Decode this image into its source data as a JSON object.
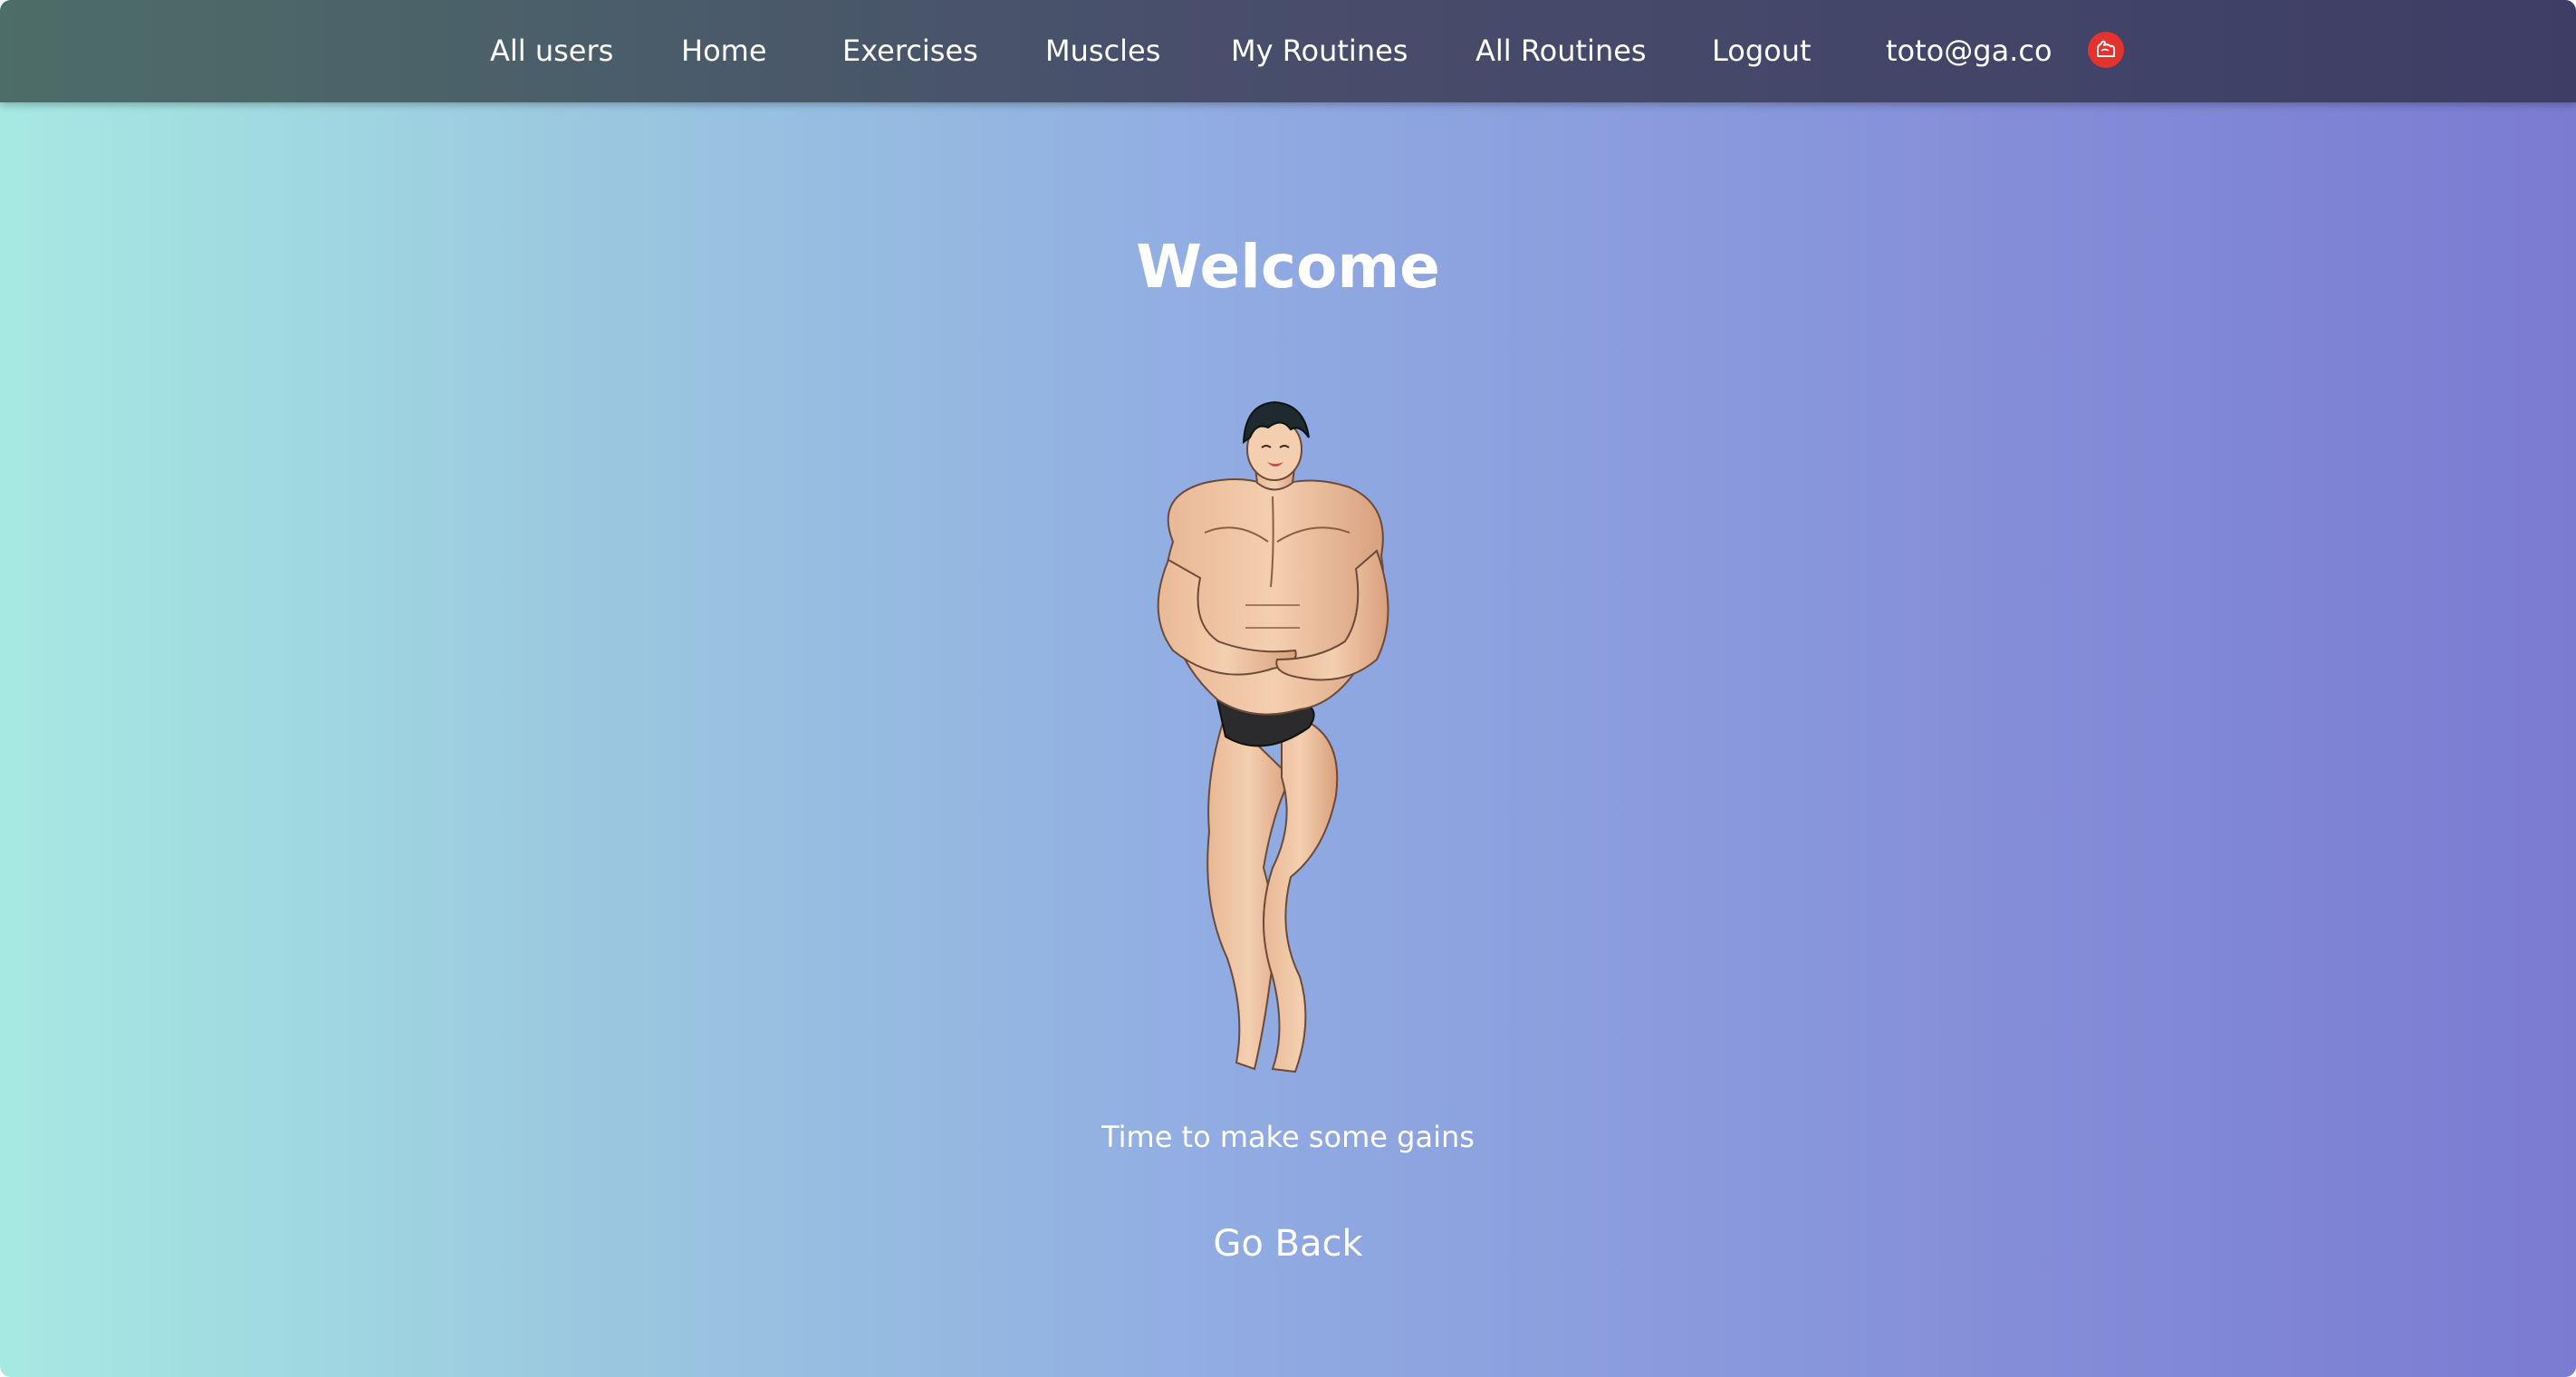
{
  "nav": {
    "all_users": "All users",
    "home": "Home",
    "exercises": "Exercises",
    "muscles": "Muscles",
    "my_routines": "My Routines",
    "all_routines": "All Routines",
    "logout": "Logout",
    "user_email": "toto@ga.co",
    "logo_icon": "flexed-arm-icon"
  },
  "main": {
    "title": "Welcome",
    "image_subject": "muscular-cartoon-bodybuilder",
    "tagline": "Time to make some gains",
    "go_back": "Go Back"
  },
  "colors": {
    "navbar_start": "#4d6d68",
    "navbar_end": "#3e3d66",
    "background_start": "#a6e9e2",
    "background_end": "#7b7bd2",
    "logo_badge": "#e3332e",
    "text": "#ffffff"
  }
}
